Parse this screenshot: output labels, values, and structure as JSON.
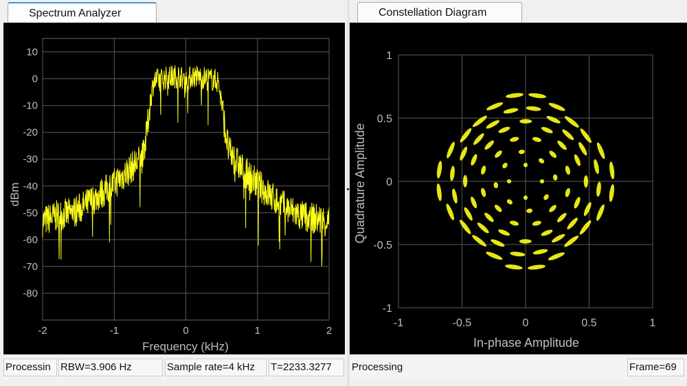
{
  "left": {
    "tab_label": "Spectrum Analyzer",
    "status": {
      "processing": "Processin",
      "rbw": "RBW=3.906 Hz",
      "sample_rate": "Sample rate=4 kHz",
      "time": "T=2233.3277"
    }
  },
  "right": {
    "tab_label": "Constellation Diagram",
    "status": {
      "processing": "Processing",
      "frame": "Frame=69"
    }
  },
  "colors": {
    "trace": "#ffff1a",
    "plot_bg": "#000000",
    "grid": "#5a5a5a",
    "axis_text": "#bfbfbf",
    "tab_accent": "#4d8fd1"
  },
  "chart_data": [
    {
      "type": "line",
      "xlabel": "Frequency (kHz)",
      "ylabel": "dBm",
      "xlim": [
        -2,
        2
      ],
      "ylim": [
        -90,
        15
      ],
      "x_ticks": [
        "-2",
        "-1",
        "0",
        "1",
        "2"
      ],
      "y_ticks": [
        "10",
        "0",
        "-10",
        "-20",
        "-30",
        "-40",
        "-50",
        "-60",
        "-70",
        "-80"
      ],
      "grid": true,
      "series": [
        {
          "x": [
            -2.0,
            -1.8,
            -1.6,
            -1.4,
            -1.2,
            -1.0,
            -0.8,
            -0.6,
            -0.55,
            -0.5,
            -0.45,
            -0.3,
            -0.1,
            0.0,
            0.1,
            0.3,
            0.45,
            0.5,
            0.55,
            0.6,
            0.8,
            1.0,
            1.2,
            1.4,
            1.6,
            1.8,
            2.0
          ],
          "y": [
            -52,
            -50,
            -49,
            -46,
            -42,
            -38,
            -33,
            -28,
            -20,
            -8,
            0,
            1,
            2,
            0,
            2,
            1,
            0,
            -8,
            -18,
            -26,
            -33,
            -38,
            -43,
            -47,
            -50,
            -51,
            -52
          ]
        }
      ]
    },
    {
      "type": "scatter",
      "xlabel": "In-phase Amplitude",
      "ylabel": "Quadrature Amplitude",
      "xlim": [
        -1,
        1
      ],
      "ylim": [
        -1,
        1
      ],
      "x_ticks": [
        "-1",
        "-0.5",
        "0",
        "0.5",
        "1"
      ],
      "y_ticks": [
        "1",
        "0.5",
        "0",
        "-0.5",
        "-1"
      ],
      "grid": true,
      "rings": [
        0.12,
        0.22,
        0.33,
        0.44,
        0.54,
        0.64
      ],
      "points_per_ring": [
        4,
        8,
        12,
        16,
        20,
        24
      ]
    }
  ]
}
